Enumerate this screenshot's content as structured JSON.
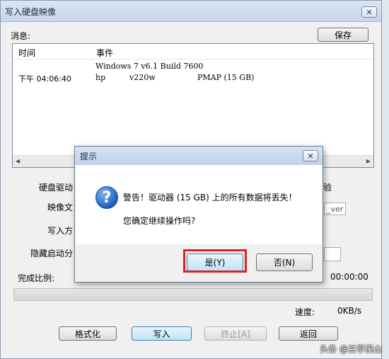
{
  "window": {
    "title": "写入硬盘映像"
  },
  "main": {
    "messages_label": "消息:",
    "save_button": "保存",
    "log": {
      "columns": [
        "时间",
        "事件"
      ],
      "rows": [
        {
          "time": "",
          "c1": "Windows 7 v6.1 Build 7600",
          "c2": "",
          "c3": ""
        },
        {
          "time": "下午 04:06:40",
          "c1": "hp",
          "c2": "v220w",
          "c3": "PMAP  (15 GB)"
        }
      ]
    },
    "disk_drive_label": "硬盘驱动",
    "disk_drive_right": "验",
    "image_file_label": "映像文",
    "image_file_suffix": "_ver",
    "write_method_label": "写入方",
    "hide_boot_label": "隐藏启动分",
    "progress_label": "完成比例:",
    "elapsed_time": "00:00:00",
    "progress_fraction": 0,
    "speed_label": "速度:",
    "speed_value": "0KB/s",
    "buttons": {
      "format": "格式化",
      "write": "写入",
      "abort": "终止[A]",
      "back": "返回"
    }
  },
  "dialog": {
    "title": "提示",
    "warning": "警告！驱动器 (15 GB) 上的所有数据将丢失！",
    "question": "您确定继续操作吗?",
    "yes_button": "是(Y)",
    "no_button": "否(N)"
  },
  "watermark": "头条 @兰亭溪山",
  "colors": {
    "highlight": "#e02020",
    "progress": "#3fb34f"
  }
}
